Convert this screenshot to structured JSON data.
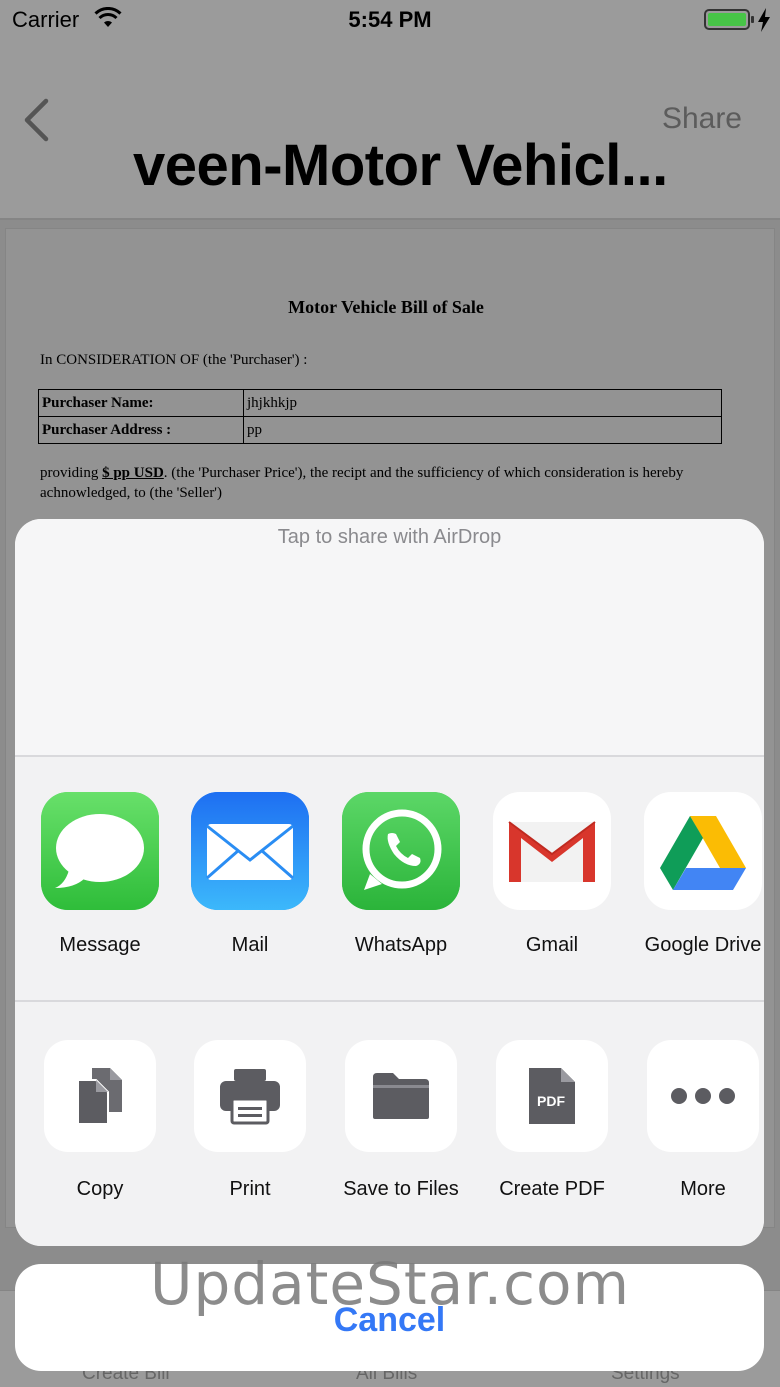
{
  "status_bar": {
    "carrier": "Carrier",
    "time": "5:54 PM"
  },
  "nav": {
    "share_label": "Share",
    "title": "veen-Motor Vehicl..."
  },
  "document": {
    "title": "Motor Vehicle Bill of Sale",
    "consideration": "In CONSIDERATION OF (the 'Purchaser') :",
    "rows": [
      {
        "label": "Purchaser Name:",
        "value": "jhjkhkjp"
      },
      {
        "label": "Purchaser Address :",
        "value": "pp"
      }
    ],
    "para_prefix": "providing ",
    "para_amount": "$ pp USD",
    "para_rest": ". (the 'Purchaser Price'), the recipt and the sufficiency of which consideration is hereby achnowledged, to (the 'Seller')"
  },
  "tabs": [
    "Create Bill",
    "All Bills",
    "Settings"
  ],
  "share_sheet": {
    "airdrop_label": "Tap to share with AirDrop",
    "apps": [
      {
        "label": "Message",
        "icon": "message-icon"
      },
      {
        "label": "Mail",
        "icon": "mail-icon"
      },
      {
        "label": "WhatsApp",
        "icon": "whatsapp-icon"
      },
      {
        "label": "Gmail",
        "icon": "gmail-icon"
      },
      {
        "label": "Google Drive",
        "icon": "google-drive-icon"
      }
    ],
    "actions": [
      {
        "label": "Copy",
        "icon": "copy-icon"
      },
      {
        "label": "Print",
        "icon": "print-icon"
      },
      {
        "label": "Save to Files",
        "icon": "folder-icon"
      },
      {
        "label": "Create PDF",
        "icon": "pdf-icon",
        "badge": "PDF"
      },
      {
        "label": "More",
        "icon": "more-icon"
      }
    ],
    "cancel_label": "Cancel"
  },
  "watermark": "UpdateStar.com",
  "colors": {
    "accent": "#3478f6",
    "message_green": "#4cd964",
    "whatsapp_green": "#38c24a",
    "mail_blue": "#1e8cf5",
    "battery_green": "#47c447"
  }
}
